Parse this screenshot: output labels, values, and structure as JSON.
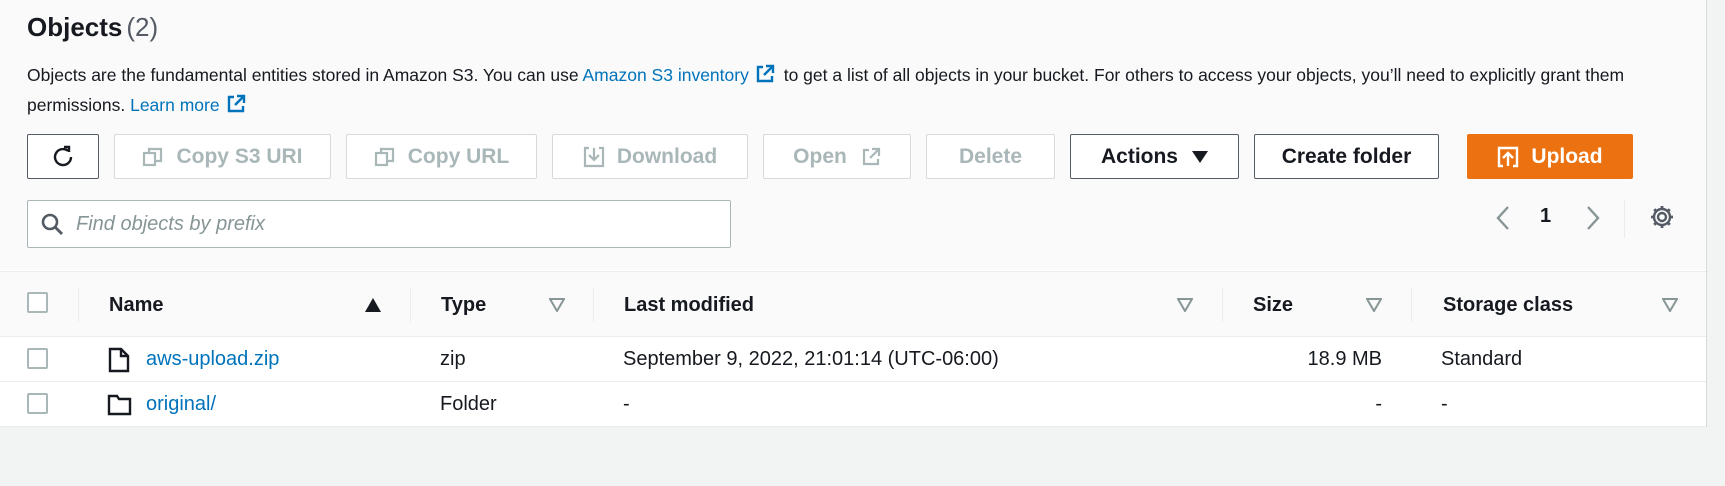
{
  "header": {
    "title": "Objects",
    "count": "(2)",
    "description_part1": "Objects are the fundamental entities stored in Amazon S3. You can use ",
    "inventory_link": "Amazon S3 inventory",
    "description_part2": " to get a list of all objects in your bucket. For others to access your objects, you’ll need to explicitly grant them permissions. ",
    "learn_more_link": "Learn more"
  },
  "toolbar": {
    "copy_s3_uri": "Copy S3 URI",
    "copy_url": "Copy URL",
    "download": "Download",
    "open": "Open",
    "delete": "Delete",
    "actions": "Actions",
    "create_folder": "Create folder",
    "upload": "Upload"
  },
  "search": {
    "placeholder": "Find objects by prefix",
    "value": ""
  },
  "pagination": {
    "current_page": "1"
  },
  "table": {
    "columns": [
      "Name",
      "Type",
      "Last modified",
      "Size",
      "Storage class"
    ],
    "rows": [
      {
        "name": "aws-upload.zip",
        "icon": "file-icon",
        "type": "zip",
        "last_modified": "September 9, 2022, 21:01:14 (UTC-06:00)",
        "size": "18.9 MB",
        "storage_class": "Standard"
      },
      {
        "name": "original/",
        "icon": "folder-icon",
        "type": "Folder",
        "last_modified": "-",
        "size": "-",
        "storage_class": "-"
      }
    ]
  },
  "colors": {
    "link": "#0073bb",
    "primary": "#ec7211",
    "disabled": "#aab7b8"
  }
}
